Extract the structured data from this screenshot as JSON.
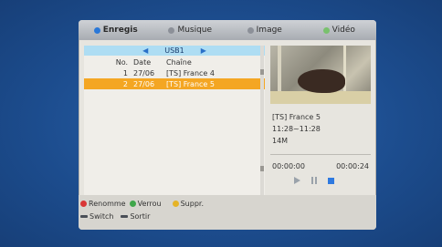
{
  "tabs": [
    {
      "label": "Enregis",
      "icon": "record-icon",
      "active": true
    },
    {
      "label": "Musique",
      "icon": "music-icon",
      "active": false
    },
    {
      "label": "Image",
      "icon": "image-icon",
      "active": false
    },
    {
      "label": "Vidéo",
      "icon": "video-icon",
      "active": false
    }
  ],
  "list": {
    "source": "USB1",
    "headers": {
      "no": "No.",
      "date": "Date",
      "channel": "Chaîne"
    },
    "rows": [
      {
        "no": "1",
        "date": "27/06",
        "channel": "[TS] France 4"
      },
      {
        "no": "2",
        "date": "27/06",
        "channel": "[TS] France 5"
      }
    ]
  },
  "preview": {
    "channel": "[TS] France 5",
    "time_range": "11:28~11:28",
    "size": "14M",
    "elapsed": "00:00:00",
    "total": "00:00:24"
  },
  "legend": {
    "rename": "Renomme",
    "lock": "Verrou",
    "delete": "Suppr.",
    "switch": "Switch",
    "exit": "Sortir"
  },
  "colors": {
    "selected_row": "#f4a623",
    "source_bar": "#aeddf3",
    "panel": "#e7e5df",
    "background": "#1f4f8f"
  }
}
